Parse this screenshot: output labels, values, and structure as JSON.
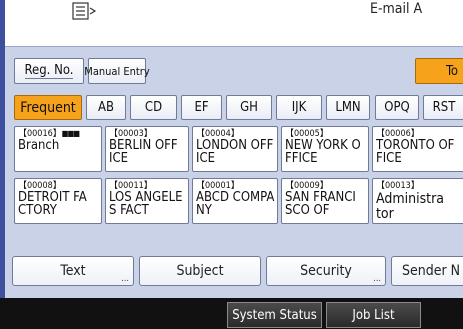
{
  "header": {
    "email_label": "E-mail A"
  },
  "top_buttons": {
    "reg_no": "Reg. No.",
    "manual_entry": "Manual Entry",
    "to": "To"
  },
  "index_tabs": [
    "Frequent",
    "AB",
    "CD",
    "EF",
    "GH",
    "IJK",
    "LMN",
    "OPQ",
    "RST"
  ],
  "destinations": [
    {
      "num": "【00016】",
      "group_icon": "■■■",
      "lines": [
        "Branch"
      ]
    },
    {
      "num": "【00003】",
      "lines": [
        "BERLIN OFF",
        "ICE"
      ]
    },
    {
      "num": "【00004】",
      "lines": [
        "LONDON OFF",
        "ICE"
      ]
    },
    {
      "num": "【00005】",
      "lines": [
        "NEW YORK O",
        "FFICE"
      ]
    },
    {
      "num": "【00006】",
      "lines": [
        "TORONTO OF",
        "FICE"
      ]
    },
    {
      "num": "【00008】",
      "lines": [
        "DETROIT FA",
        "CTORY"
      ]
    },
    {
      "num": "【00011】",
      "lines": [
        "LOS ANGELE",
        "S FACT"
      ]
    },
    {
      "num": "【00001】",
      "lines": [
        "ABCD COMPA",
        "NY"
      ]
    },
    {
      "num": "【00009】",
      "lines": [
        "SAN FRANCI",
        "SCO OF"
      ]
    },
    {
      "num": "【00013】",
      "lines": [
        "Administra",
        "tor"
      ]
    }
  ],
  "bottom_tabs": {
    "text": "Text",
    "subject": "Subject",
    "security": "Security",
    "sender": "Sender N",
    "more": "..."
  },
  "status_bar": {
    "system_status": "System Status",
    "job_list": "Job List"
  },
  "colors": {
    "panel": "#c9d2e6",
    "selected": "#f7a21b",
    "left_bar": "#3e4fa0",
    "status_bar": "#111111"
  }
}
